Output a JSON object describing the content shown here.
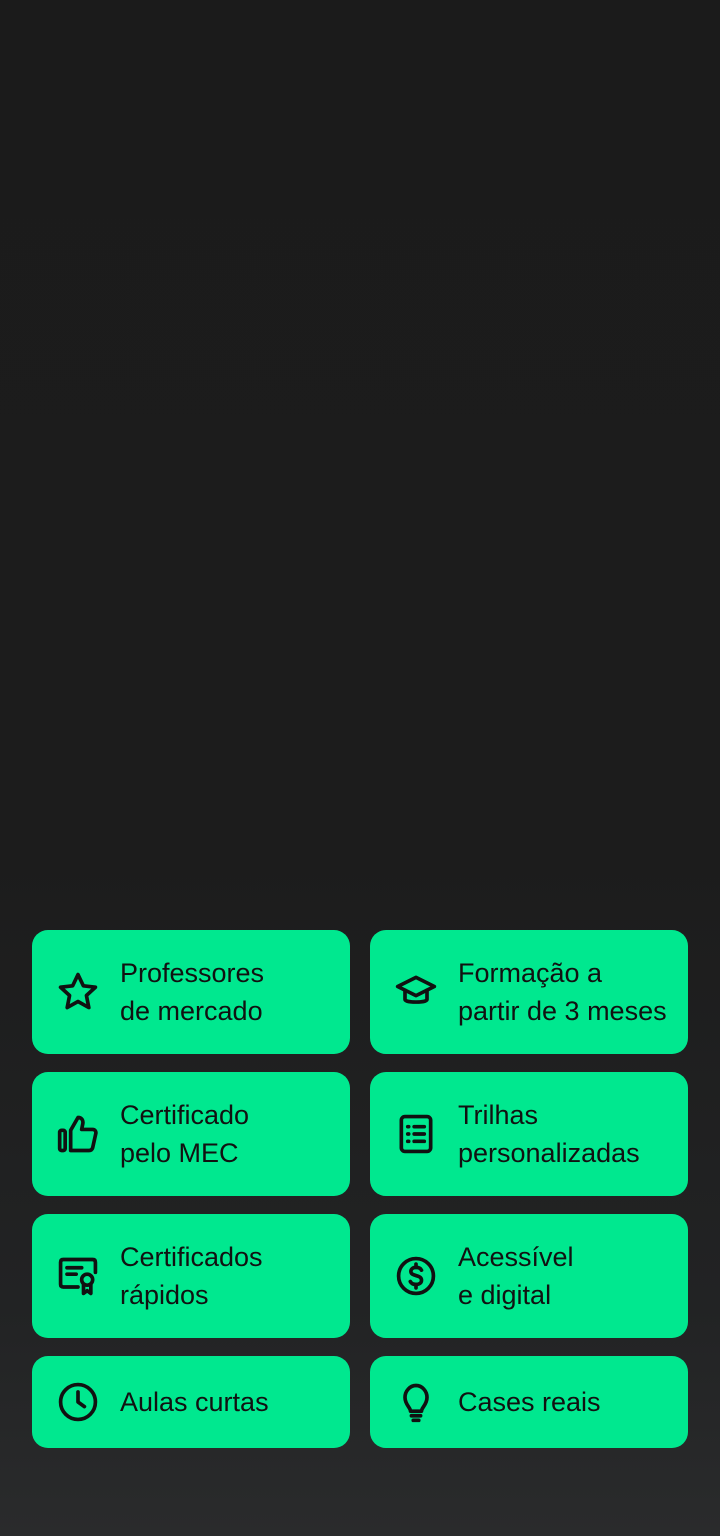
{
  "features": [
    {
      "icon": "star-icon",
      "label": "Professores\nde mercado"
    },
    {
      "icon": "graduation-cap-icon",
      "label": "Formação a\npartir de 3 meses"
    },
    {
      "icon": "thumbs-up-icon",
      "label": "Certificado\npelo MEC"
    },
    {
      "icon": "list-icon",
      "label": "Trilhas\npersonalizadas"
    },
    {
      "icon": "certificate-icon",
      "label": "Certificados\nrápidos"
    },
    {
      "icon": "dollar-circle-icon",
      "label": "Acessível\ne digital"
    },
    {
      "icon": "clock-icon",
      "label": "Aulas curtas"
    },
    {
      "icon": "lightbulb-icon",
      "label": "Cases reais"
    }
  ],
  "colors": {
    "card_background": "#00e88f",
    "page_background": "#1c1c1c",
    "text": "#111111"
  }
}
